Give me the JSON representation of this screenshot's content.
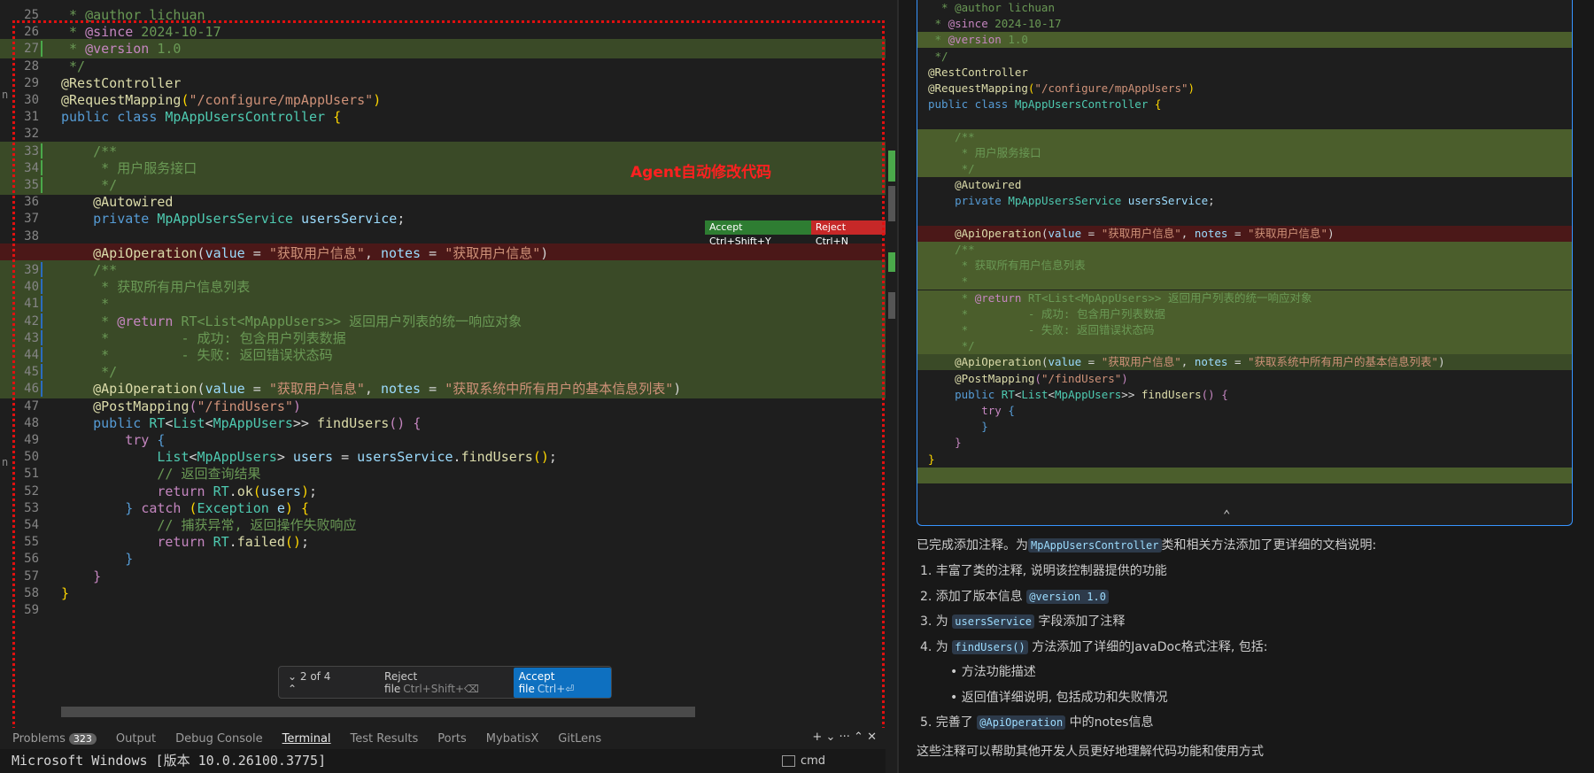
{
  "editor": {
    "lines": [
      {
        "n": "25",
        "bg": "",
        "bar": "",
        "segs": [
          [
            "c",
            " * @author lichuan"
          ]
        ]
      },
      {
        "n": "26",
        "bg": "",
        "bar": "",
        "segs": [
          [
            "c",
            " * "
          ],
          [
            "kw",
            "@since"
          ],
          [
            "c",
            " 2024-10-17"
          ]
        ]
      },
      {
        "n": "27",
        "bg": "g",
        "bar": "#4aa84a",
        "segs": [
          [
            "c",
            " * "
          ],
          [
            "kw",
            "@version"
          ],
          [
            "c",
            " 1.0"
          ]
        ]
      },
      {
        "n": "28",
        "bg": "",
        "bar": "",
        "segs": [
          [
            "c",
            " */"
          ]
        ]
      },
      {
        "n": "29",
        "bg": "",
        "bar": "",
        "segs": [
          [
            "a",
            "@RestController"
          ]
        ]
      },
      {
        "n": "30",
        "bg": "",
        "bar": "",
        "segs": [
          [
            "a",
            "@RequestMapping"
          ],
          [
            "y",
            "("
          ],
          [
            "s",
            "\"/configure/mpAppUsers\""
          ],
          [
            "y",
            ")"
          ]
        ]
      },
      {
        "n": "31",
        "bg": "",
        "bar": "",
        "segs": [
          [
            "k",
            "public class "
          ],
          [
            "t",
            "MpAppUsersController"
          ],
          [
            "p",
            " "
          ],
          [
            "y",
            "{"
          ]
        ]
      },
      {
        "n": "32",
        "bg": "",
        "bar": "",
        "segs": [
          [
            "p",
            ""
          ]
        ]
      },
      {
        "n": "33",
        "bg": "g",
        "bar": "#4aa84a",
        "segs": [
          [
            "c",
            "    /**"
          ]
        ]
      },
      {
        "n": "34",
        "bg": "g",
        "bar": "#4aa84a",
        "segs": [
          [
            "c",
            "     * 用户服务接口"
          ]
        ]
      },
      {
        "n": "35",
        "bg": "g",
        "bar": "#4aa84a",
        "segs": [
          [
            "c",
            "     */"
          ]
        ]
      },
      {
        "n": "36",
        "bg": "",
        "bar": "",
        "segs": [
          [
            "a",
            "    @Autowired"
          ]
        ]
      },
      {
        "n": "37",
        "bg": "",
        "bar": "",
        "segs": [
          [
            "k",
            "    private "
          ],
          [
            "t",
            "MpAppUsersService"
          ],
          [
            "p",
            " "
          ],
          [
            "v",
            "usersService"
          ],
          [
            "p",
            ";"
          ]
        ]
      },
      {
        "n": "38",
        "bg": "",
        "bar": "",
        "segs": [
          [
            "p",
            ""
          ]
        ]
      },
      {
        "n": "",
        "bg": "r",
        "bar": "",
        "segs": [
          [
            "a",
            "    @ApiOperation"
          ],
          [
            "p",
            "("
          ],
          [
            "v",
            "value"
          ],
          [
            "p",
            " = "
          ],
          [
            "s",
            "\"获取用户信息\""
          ],
          [
            "p",
            ", "
          ],
          [
            "v",
            "notes"
          ],
          [
            "p",
            " = "
          ],
          [
            "s",
            "\"获取用户信息\""
          ],
          [
            "p",
            ")"
          ]
        ]
      },
      {
        "n": "39",
        "bg": "g",
        "bar": "#2b6cbf",
        "segs": [
          [
            "c",
            "    /**"
          ]
        ]
      },
      {
        "n": "40",
        "bg": "g",
        "bar": "#2b6cbf",
        "segs": [
          [
            "c",
            "     * 获取所有用户信息列表"
          ]
        ]
      },
      {
        "n": "41",
        "bg": "g",
        "bar": "#2b6cbf",
        "segs": [
          [
            "c",
            "     *"
          ]
        ]
      },
      {
        "n": "42",
        "bg": "g",
        "bar": "#2b6cbf",
        "segs": [
          [
            "c",
            "     * "
          ],
          [
            "kw",
            "@return"
          ],
          [
            "c",
            " RT<List<MpAppUsers>> 返回用户列表的统一响应对象"
          ]
        ]
      },
      {
        "n": "43",
        "bg": "g",
        "bar": "#2b6cbf",
        "segs": [
          [
            "c",
            "     *         - 成功: 包含用户列表数据"
          ]
        ]
      },
      {
        "n": "44",
        "bg": "g",
        "bar": "#2b6cbf",
        "segs": [
          [
            "c",
            "     *         - 失败: 返回错误状态码"
          ]
        ]
      },
      {
        "n": "45",
        "bg": "g",
        "bar": "#2b6cbf",
        "segs": [
          [
            "c",
            "     */"
          ]
        ]
      },
      {
        "n": "46",
        "bg": "g",
        "bar": "#2b6cbf",
        "segs": [
          [
            "a",
            "    @ApiOperation"
          ],
          [
            "p",
            "("
          ],
          [
            "v",
            "value"
          ],
          [
            "p",
            " = "
          ],
          [
            "s",
            "\"获取用户信息\""
          ],
          [
            "p",
            ", "
          ],
          [
            "v",
            "notes"
          ],
          [
            "p",
            " = "
          ],
          [
            "s",
            "\"获取系统中所有用户的基本信息列表\""
          ],
          [
            "p",
            ")"
          ]
        ]
      },
      {
        "n": "47",
        "bg": "",
        "bar": "",
        "segs": [
          [
            "a",
            "    @PostMapping"
          ],
          [
            "kw",
            "("
          ],
          [
            "s",
            "\"/findUsers\""
          ],
          [
            "kw",
            ")"
          ]
        ]
      },
      {
        "n": "48",
        "bg": "",
        "bar": "",
        "segs": [
          [
            "k",
            "    public "
          ],
          [
            "t",
            "RT"
          ],
          [
            "p",
            "<"
          ],
          [
            "t",
            "List"
          ],
          [
            "p",
            "<"
          ],
          [
            "t",
            "MpAppUsers"
          ],
          [
            "p",
            ">> "
          ],
          [
            "a",
            "findUsers"
          ],
          [
            "kw",
            "()"
          ],
          [
            "p",
            " "
          ],
          [
            "kw",
            "{"
          ]
        ]
      },
      {
        "n": "49",
        "bg": "",
        "bar": "",
        "segs": [
          [
            "kw",
            "        try "
          ],
          [
            "k",
            "{"
          ]
        ]
      },
      {
        "n": "50",
        "bg": "",
        "bar": "",
        "segs": [
          [
            "t",
            "            List"
          ],
          [
            "p",
            "<"
          ],
          [
            "t",
            "MpAppUsers"
          ],
          [
            "p",
            "> "
          ],
          [
            "v",
            "users"
          ],
          [
            "p",
            " = "
          ],
          [
            "v",
            "usersService"
          ],
          [
            "p",
            "."
          ],
          [
            "a",
            "findUsers"
          ],
          [
            "y",
            "()"
          ],
          [
            "p",
            ";"
          ]
        ]
      },
      {
        "n": "51",
        "bg": "",
        "bar": "",
        "segs": [
          [
            "c",
            "            // 返回查询结果"
          ]
        ]
      },
      {
        "n": "52",
        "bg": "",
        "bar": "",
        "segs": [
          [
            "kw",
            "            return "
          ],
          [
            "t",
            "RT"
          ],
          [
            "p",
            "."
          ],
          [
            "a",
            "ok"
          ],
          [
            "y",
            "("
          ],
          [
            "v",
            "users"
          ],
          [
            "y",
            ")"
          ],
          [
            "p",
            ";"
          ]
        ]
      },
      {
        "n": "53",
        "bg": "",
        "bar": "",
        "segs": [
          [
            "k",
            "        } "
          ],
          [
            "kw",
            "catch "
          ],
          [
            "y",
            "("
          ],
          [
            "t",
            "Exception"
          ],
          [
            "p",
            " "
          ],
          [
            "v",
            "e"
          ],
          [
            "y",
            ")"
          ],
          [
            "p",
            " "
          ],
          [
            "y",
            "{"
          ]
        ]
      },
      {
        "n": "54",
        "bg": "",
        "bar": "",
        "segs": [
          [
            "c",
            "            // 捕获异常, 返回操作失败响应"
          ]
        ]
      },
      {
        "n": "55",
        "bg": "",
        "bar": "",
        "segs": [
          [
            "kw",
            "            return "
          ],
          [
            "t",
            "RT"
          ],
          [
            "p",
            "."
          ],
          [
            "a",
            "failed"
          ],
          [
            "y",
            "()"
          ],
          [
            "p",
            ";"
          ]
        ]
      },
      {
        "n": "56",
        "bg": "",
        "bar": "",
        "segs": [
          [
            "k",
            "        }"
          ]
        ]
      },
      {
        "n": "57",
        "bg": "",
        "bar": "",
        "segs": [
          [
            "kw",
            "    }"
          ]
        ]
      },
      {
        "n": "58",
        "bg": "",
        "bar": "",
        "segs": [
          [
            "y",
            "}"
          ]
        ]
      },
      {
        "n": "59",
        "bg": "",
        "bar": "",
        "segs": [
          [
            "p",
            ""
          ]
        ]
      }
    ],
    "accept_label": "Accept Ctrl+Shift+Y",
    "reject_label": "Reject Ctrl+N",
    "annotation": "Agent自动修改代码",
    "nav": {
      "count": "2 of 4",
      "reject_file": "Reject file",
      "reject_shortcut": "Ctrl+Shift+⌫",
      "accept_file": "Accept file",
      "accept_shortcut": "Ctrl+⏎"
    }
  },
  "panel": {
    "tabs": [
      "Problems",
      "Output",
      "Debug Console",
      "Terminal",
      "Test Results",
      "Ports",
      "MybatisX",
      "GitLens"
    ],
    "problems_count": "323",
    "active_tab": "Terminal",
    "terminal_text": "Microsoft Windows [版本 10.0.26100.3775]",
    "shell": "cmd"
  },
  "chat": {
    "code_lines": [
      {
        "bg": "",
        "segs": [
          [
            "c",
            "  * @author lichuan"
          ]
        ]
      },
      {
        "bg": "",
        "segs": [
          [
            "c",
            " * "
          ],
          [
            "kw",
            "@since"
          ],
          [
            "c",
            " 2024-10-17"
          ]
        ]
      },
      {
        "bg": "g",
        "segs": [
          [
            "c",
            " * "
          ],
          [
            "kw",
            "@version"
          ],
          [
            "c",
            " 1.0"
          ]
        ]
      },
      {
        "bg": "",
        "segs": [
          [
            "c",
            " */"
          ]
        ]
      },
      {
        "bg": "",
        "segs": [
          [
            "a",
            "@RestController"
          ]
        ]
      },
      {
        "bg": "",
        "segs": [
          [
            "a",
            "@RequestMapping"
          ],
          [
            "y",
            "("
          ],
          [
            "s",
            "\"/configure/mpAppUsers\""
          ],
          [
            "y",
            ")"
          ]
        ]
      },
      {
        "bg": "",
        "segs": [
          [
            "k",
            "public class "
          ],
          [
            "t",
            "MpAppUsersController"
          ],
          [
            "p",
            " "
          ],
          [
            "y",
            "{"
          ]
        ]
      },
      {
        "bg": "",
        "segs": [
          [
            "p",
            ""
          ]
        ]
      },
      {
        "bg": "g",
        "segs": [
          [
            "c",
            "    /**"
          ]
        ]
      },
      {
        "bg": "g",
        "segs": [
          [
            "c",
            "     * 用户服务接口"
          ]
        ]
      },
      {
        "bg": "g",
        "segs": [
          [
            "c",
            "     */"
          ]
        ]
      },
      {
        "bg": "",
        "segs": [
          [
            "a",
            "    @Autowired"
          ]
        ]
      },
      {
        "bg": "",
        "segs": [
          [
            "k",
            "    private "
          ],
          [
            "t",
            "MpAppUsersService"
          ],
          [
            "p",
            " "
          ],
          [
            "v",
            "usersService"
          ],
          [
            "p",
            ";"
          ]
        ]
      },
      {
        "bg": "",
        "segs": [
          [
            "p",
            ""
          ]
        ]
      },
      {
        "bg": "r",
        "segs": [
          [
            "a",
            "    @ApiOperation"
          ],
          [
            "p",
            "("
          ],
          [
            "v",
            "value"
          ],
          [
            "p",
            " = "
          ],
          [
            "s",
            "\"获取用户信息\""
          ],
          [
            "p",
            ", "
          ],
          [
            "v",
            "notes"
          ],
          [
            "p",
            " = "
          ],
          [
            "s",
            "\"获取用户信息\""
          ],
          [
            "p",
            ")"
          ]
        ]
      },
      {
        "bg": "g",
        "segs": [
          [
            "c",
            "    /**"
          ]
        ]
      },
      {
        "bg": "g",
        "segs": [
          [
            "c",
            "     * 获取所有用户信息列表"
          ]
        ]
      },
      {
        "bg": "g",
        "segs": [
          [
            "c",
            "     *"
          ]
        ]
      },
      {
        "bg": "g",
        "segs": [
          [
            "c",
            "     * "
          ],
          [
            "kw",
            "@return"
          ],
          [
            "c",
            " RT<List<MpAppUsers>> 返回用户列表的统一响应对象"
          ]
        ]
      },
      {
        "bg": "g",
        "segs": [
          [
            "c",
            "     *         - 成功: 包含用户列表数据"
          ]
        ]
      },
      {
        "bg": "g",
        "segs": [
          [
            "c",
            "     *         - 失败: 返回错误状态码"
          ]
        ]
      },
      {
        "bg": "g",
        "segs": [
          [
            "c",
            "     */"
          ]
        ]
      },
      {
        "bg": "dg",
        "segs": [
          [
            "a",
            "    @ApiOperation"
          ],
          [
            "p",
            "("
          ],
          [
            "v",
            "value"
          ],
          [
            "p",
            " = "
          ],
          [
            "s",
            "\"获取用户信息\""
          ],
          [
            "p",
            ", "
          ],
          [
            "v",
            "notes"
          ],
          [
            "p",
            " = "
          ],
          [
            "s",
            "\"获取系统中所有用户的基本信息列表\""
          ],
          [
            "p",
            ")"
          ]
        ]
      },
      {
        "bg": "",
        "segs": [
          [
            "a",
            "    @PostMapping"
          ],
          [
            "kw",
            "("
          ],
          [
            "s",
            "\"/findUsers\""
          ],
          [
            "kw",
            ")"
          ]
        ]
      },
      {
        "bg": "",
        "segs": [
          [
            "k",
            "    public "
          ],
          [
            "t",
            "RT"
          ],
          [
            "p",
            "<"
          ],
          [
            "t",
            "List"
          ],
          [
            "p",
            "<"
          ],
          [
            "t",
            "MpAppUsers"
          ],
          [
            "p",
            ">> "
          ],
          [
            "a",
            "findUsers"
          ],
          [
            "kw",
            "()"
          ],
          [
            "p",
            " "
          ],
          [
            "kw",
            "{"
          ]
        ]
      },
      {
        "bg": "",
        "segs": [
          [
            "kw",
            "        try "
          ],
          [
            "k",
            "{"
          ]
        ]
      },
      {
        "bg": "",
        "segs": [
          [
            "k",
            "        }"
          ]
        ]
      },
      {
        "bg": "",
        "segs": [
          [
            "kw",
            "    }"
          ]
        ]
      },
      {
        "bg": "",
        "segs": [
          [
            "y",
            "}"
          ]
        ]
      },
      {
        "bg": "g",
        "segs": [
          [
            "p",
            ""
          ]
        ]
      }
    ],
    "summary": "已完成添加注释。为",
    "summary_code": "MpAppUsersController",
    "summary_tail": "类和相关方法添加了更详细的文档说明:",
    "items": [
      {
        "pre": "1. 丰富了类的注释, 说明该控制器提供的功能",
        "code": "",
        "post": ""
      },
      {
        "pre": "2. 添加了版本信息 ",
        "code": "@version 1.0",
        "post": ""
      },
      {
        "pre": "3. 为 ",
        "code": "usersService",
        "post": " 字段添加了注释"
      },
      {
        "pre": "4. 为 ",
        "code": "findUsers()",
        "post": " 方法添加了详细的JavaDoc格式注释, 包括:"
      },
      {
        "pre": "•  方法功能描述",
        "code": "",
        "post": ""
      },
      {
        "pre": "•  返回值详细说明, 包括成功和失败情况",
        "code": "",
        "post": ""
      },
      {
        "pre": "5. 完善了 ",
        "code": "@ApiOperation",
        "post": " 中的notes信息"
      }
    ],
    "closing": "这些注释可以帮助其他开发人员更好地理解代码功能和使用方式"
  },
  "colors": {
    "accent": "#3794ff",
    "added": "#3a4a27",
    "removed": "#4b1818",
    "annotation": "#ff2020"
  }
}
